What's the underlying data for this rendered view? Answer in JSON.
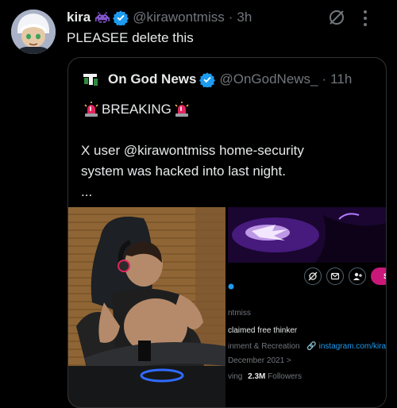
{
  "post": {
    "author_name": "kira",
    "author_handle": "@kirawontmiss",
    "time": "3h",
    "text": "PLEASEE delete this",
    "icons": [
      "avatar",
      "space-invader-emoji-icon",
      "verified-badge-icon",
      "grok-icon",
      "more-icon"
    ]
  },
  "quote": {
    "author_name": "On God News",
    "author_handle": "@OnGodNews_",
    "time": "11h",
    "breaking": "BREAKING",
    "line1": "X user @kirawontmiss home-security",
    "line2": "system was hacked into last night.",
    "ellipsis": "...",
    "icons": [
      "news-logo-icon",
      "verified-badge-icon",
      "siren-emoji-icon"
    ]
  },
  "profile_preview": {
    "handle_fragment": "ntmiss",
    "bio": "claimed free thinker",
    "category": "inment & Recreation",
    "link": "instagram.com/kira",
    "joined": "December 2021 >",
    "followers_prefix": "ving",
    "followers_count": "2.3M",
    "followers_label": "Followers",
    "subscribe_fragment": "S"
  },
  "colors": {
    "background": "#000000",
    "text": "#e7e9ea",
    "muted": "#71767b",
    "border": "#2f3336",
    "link": "#1d9bf0",
    "verified": "#1d9bf0",
    "subscribe": "#c9187a"
  }
}
